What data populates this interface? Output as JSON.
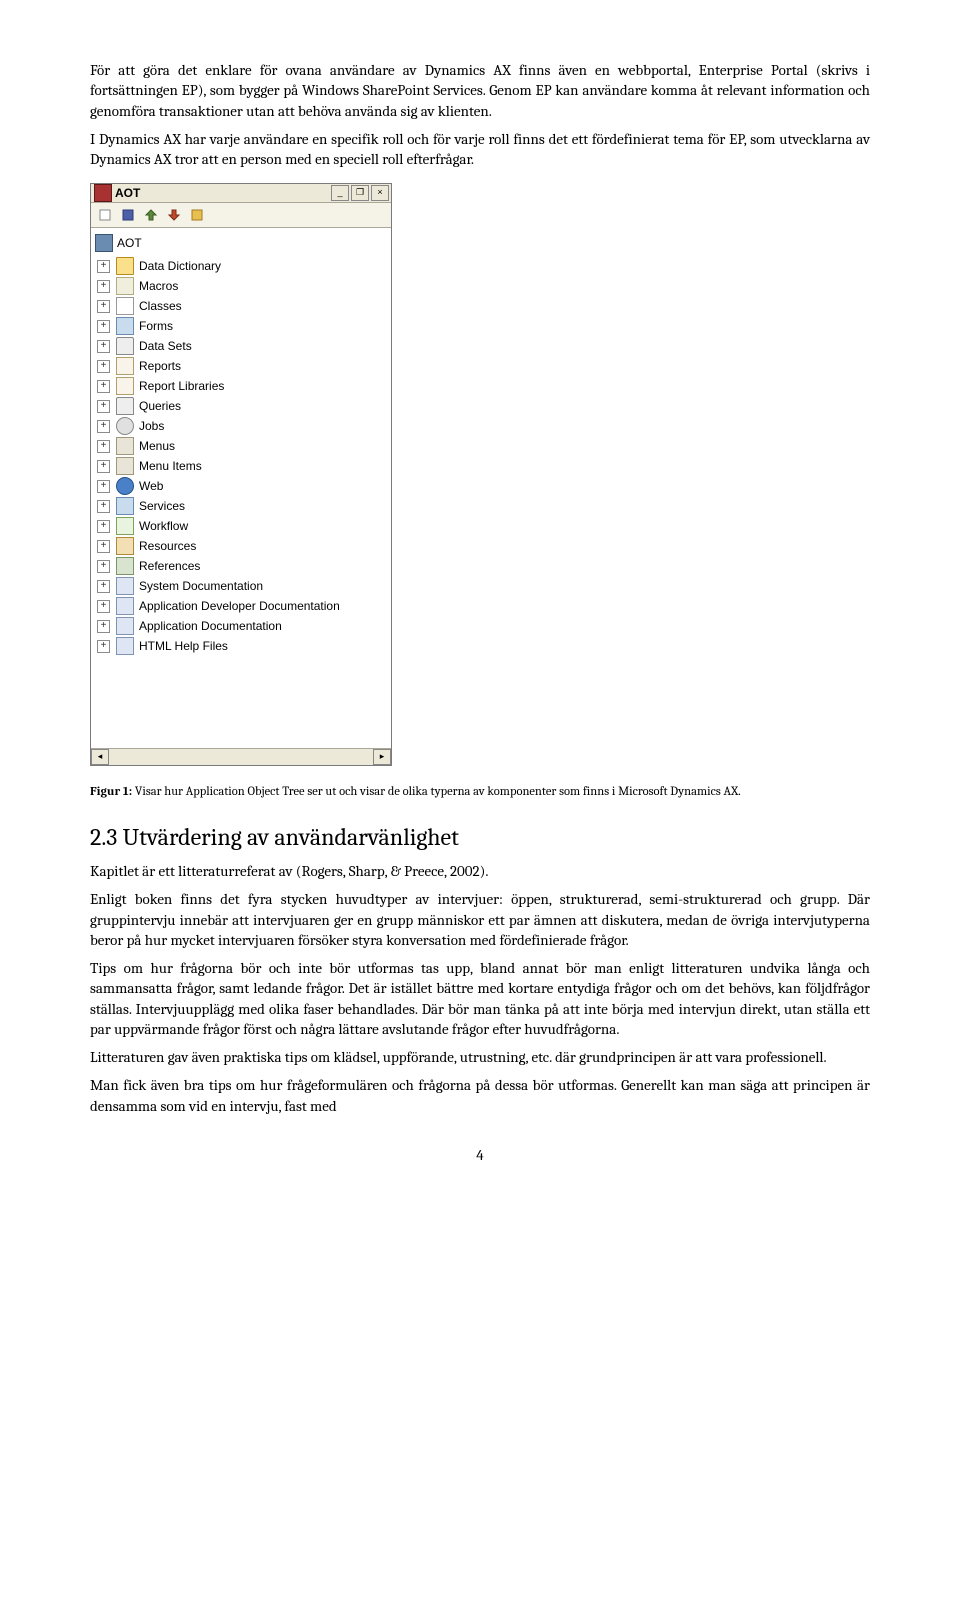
{
  "para1": "För att göra det enklare för ovana användare av Dynamics AX finns även en webbportal, Enterprise Portal (skrivs i fortsättningen EP), som bygger på Windows SharePoint Services. Genom EP kan användare komma åt relevant information och genomföra transaktioner utan att behöva använda sig av klienten.",
  "para2": "I Dynamics AX har varje användare en specifik roll och för varje roll finns det ett fördefinierat tema för EP, som utvecklarna av Dynamics AX tror att en person med en speciell roll efterfrågar.",
  "aot": {
    "title": "AOT",
    "root": "AOT",
    "nodes": [
      {
        "label": "Data Dictionary",
        "iconClass": "icon-folder"
      },
      {
        "label": "Macros",
        "iconClass": "icon-scroll"
      },
      {
        "label": "Classes",
        "iconClass": "icon-doc"
      },
      {
        "label": "Forms",
        "iconClass": "icon-form"
      },
      {
        "label": "Data Sets",
        "iconClass": "icon-db"
      },
      {
        "label": "Reports",
        "iconClass": "icon-report"
      },
      {
        "label": "Report Libraries",
        "iconClass": "icon-report"
      },
      {
        "label": "Queries",
        "iconClass": "icon-db"
      },
      {
        "label": "Jobs",
        "iconClass": "icon-gear"
      },
      {
        "label": "Menus",
        "iconClass": "icon-menu"
      },
      {
        "label": "Menu Items",
        "iconClass": "icon-menu"
      },
      {
        "label": "Web",
        "iconClass": "icon-globe"
      },
      {
        "label": "Services",
        "iconClass": "icon-form"
      },
      {
        "label": "Workflow",
        "iconClass": "icon-workflow"
      },
      {
        "label": "Resources",
        "iconClass": "icon-people"
      },
      {
        "label": "References",
        "iconClass": "icon-ref"
      },
      {
        "label": "System Documentation",
        "iconClass": "icon-help"
      },
      {
        "label": "Application Developer Documentation",
        "iconClass": "icon-help"
      },
      {
        "label": "Application Documentation",
        "iconClass": "icon-help"
      },
      {
        "label": "HTML Help Files",
        "iconClass": "icon-help"
      }
    ]
  },
  "caption_lead": "Figur 1:",
  "caption_rest": " Visar hur Application Object Tree ser ut och visar de olika typerna av komponenter som finns i Microsoft Dynamics AX.",
  "section_heading": "2.3  Utvärdering av användarvänlighet",
  "p3": "Kapitlet är ett litteraturreferat av (Rogers, Sharp, & Preece, 2002).",
  "p4": "Enligt boken finns det fyra stycken huvudtyper av intervjuer: öppen, strukturerad, semi-strukturerad och grupp. Där gruppintervju innebär att intervjuaren ger en grupp människor ett par ämnen att diskutera, medan de övriga intervjutyperna beror på hur mycket intervjuaren försöker styra konversation med fördefinierade frågor.",
  "p5": "Tips om hur frågorna bör och inte bör utformas tas upp, bland annat bör man enligt litteraturen undvika långa och sammansatta frågor, samt ledande frågor. Det är istället bättre med kortare entydiga frågor och om det behövs, kan följdfrågor ställas. Intervjuupplägg med olika faser behandlades. Där bör man tänka på att inte börja med intervjun direkt, utan ställa ett par uppvärmande frågor först och några lättare avslutande frågor efter huvudfrågorna.",
  "p6": "Litteraturen gav även praktiska tips om klädsel, uppförande, utrustning, etc. där grundprincipen är att vara professionell.",
  "p7": "Man fick även bra tips om hur frågeformulären och frågorna på dessa bör utformas. Generellt kan man säga att principen är densamma som vid en intervju, fast med",
  "pagenum": "4"
}
